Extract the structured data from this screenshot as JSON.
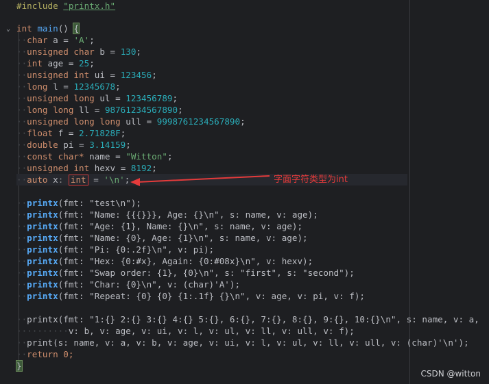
{
  "code": {
    "include_directive": "#include",
    "include_file": "\"printx.h\"",
    "main_sig_kw": "int",
    "main_sig_fn": "main",
    "main_sig_rest": "() ",
    "open_brace": "{",
    "close_brace": "}",
    "decls": [
      {
        "type": "char",
        "name": "a",
        "val": "'A'"
      },
      {
        "type": "unsigned char",
        "name": "b",
        "val": "130"
      },
      {
        "type": "int",
        "name": "age",
        "val": "25"
      },
      {
        "type": "unsigned int",
        "name": "ui",
        "val": "123456"
      },
      {
        "type": "long",
        "name": "l",
        "val": "12345678"
      },
      {
        "type": "unsigned long",
        "name": "ul",
        "val": "123456789"
      },
      {
        "type": "long long",
        "name": "ll",
        "val": "98761234567890"
      },
      {
        "type": "unsigned long long",
        "name": "ull",
        "val": "9998761234567890"
      },
      {
        "type": "float",
        "name": "f",
        "val": "2.71828F"
      },
      {
        "type": "double",
        "name": "pi",
        "val": "3.14159"
      },
      {
        "type": "const char*",
        "name": "name",
        "val": "\"Witton\""
      },
      {
        "type": "unsigned int",
        "name": "hexv",
        "val": "8192"
      }
    ],
    "auto_line": {
      "kw": "auto",
      "name": "x",
      "hint": "int",
      "val": "'\\n'"
    },
    "printx_calls": [
      {
        "fn": "printx",
        "args": "(fmt: \"test\\n\");"
      },
      {
        "fn": "printx",
        "args": "(fmt: \"Name: {{{}}}, Age: {}\\n\", s: name, v: age);"
      },
      {
        "fn": "printx",
        "args": "(fmt: \"Age: {1}, Name: {}\\n\", s: name, v: age);"
      },
      {
        "fn": "printx",
        "args": "(fmt: \"Name: {0}, Age: {1}\\n\", s: name, v: age);"
      },
      {
        "fn": "printx",
        "args": "(fmt: \"Pi: {0:.2f}\\n\", v: pi);"
      },
      {
        "fn": "printx",
        "args": "(fmt: \"Hex: {0:#x}, Again: {0:#08x}\\n\", v: hexv);"
      },
      {
        "fn": "printx",
        "args": "(fmt: \"Swap order: {1}, {0}\\n\", s: \"first\", s: \"second\");"
      },
      {
        "fn": "printx",
        "args": "(fmt: \"Char: {0}\\n\", v: (char)'A');"
      },
      {
        "fn": "printx",
        "args": "(fmt: \"Repeat: {0} {0} {1:.1f} {}\\n\", v: age, v: pi, v: f);"
      }
    ],
    "long_call_line1": "printx(fmt: \"1:{} 2:{} 3:{} 4:{} 5:{}, 6:{}, 7:{}, 8:{}, 9:{}, 10:{}\\n\", s: name, v: a,",
    "long_call_line2": "v: b, v: age, v: ui, v: l, v: ul, v: ll, v: ull, v: f);",
    "print_call": "print(s: name, v: a, v: b, v: age, v: ui, v: l, v: ul, v: ll, v: ull, v: (char)'\\n');",
    "return_stmt": "return 0;"
  },
  "annotation": "字面字符类型为int",
  "watermark": "CSDN @witton",
  "colors": {
    "background": "#1e1f22",
    "keyword": "#cf8e6d",
    "string": "#6aab73",
    "number": "#2aacb8",
    "function": "#56a8f5",
    "annotation_red": "#e53b3b"
  }
}
